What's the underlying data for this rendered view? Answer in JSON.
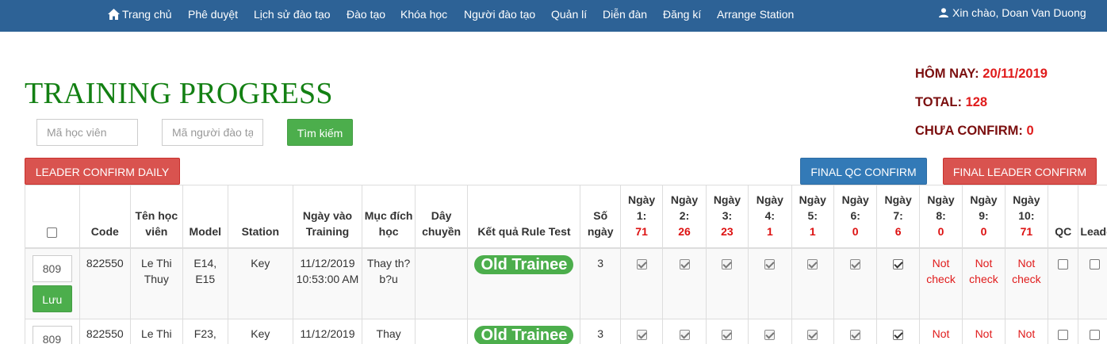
{
  "nav": {
    "items": [
      "Trang chủ",
      "Phê duyệt",
      "Lịch sử đào tạo",
      "Đào tạo",
      "Khóa học",
      "Người đào tạo",
      "Quản lí",
      "Diễn đàn",
      "Đăng kí",
      "Arrange Station"
    ],
    "user_greeting": "Xin chào, Doan Van Duong"
  },
  "page_title": "TRAINING PROGRESS",
  "stats": {
    "today_label": "HÔM NAY:",
    "today_value": "20/11/2019",
    "total_label": "TOTAL:",
    "total_value": "128",
    "unconfirmed_label": "CHƯA CONFIRM:",
    "unconfirmed_value": "0"
  },
  "search": {
    "trainee_placeholder": "Mã học viên",
    "trainer_placeholder": "Mã người đào tạo",
    "button_label": "Tìm kiếm"
  },
  "actions": {
    "leader_confirm_daily": "LEADER CONFIRM DAILY",
    "final_qc_confirm": "FINAL QC CONFIRM",
    "final_leader_confirm": "FINAL LEADER CONFIRM"
  },
  "table": {
    "headers": {
      "code": "Code",
      "name": "Tên học viên",
      "model": "Model",
      "station": "Station",
      "date_in": "Ngày vào Training",
      "purpose": "Mục đích học",
      "line": "Dây chuyền",
      "rule_test": "Kết quả Rule Test",
      "days": "Số ngày",
      "qc": "QC",
      "leader": "Leader"
    },
    "day_headers": [
      {
        "label": "Ngày 1:",
        "count": "71"
      },
      {
        "label": "Ngày 2:",
        "count": "26"
      },
      {
        "label": "Ngày 3:",
        "count": "23"
      },
      {
        "label": "Ngày 4:",
        "count": "1"
      },
      {
        "label": "Ngày 5:",
        "count": "1"
      },
      {
        "label": "Ngày 6:",
        "count": "0"
      },
      {
        "label": "Ngày 7:",
        "count": "6"
      },
      {
        "label": "Ngày 8:",
        "count": "0"
      },
      {
        "label": "Ngày 9:",
        "count": "0"
      },
      {
        "label": "Ngày 10:",
        "count": "71"
      }
    ],
    "save_label": "Lưu",
    "rows": [
      {
        "id_value": "809",
        "code": "822550",
        "name": "Le Thi Thuy",
        "model": "E14, E15",
        "station": "Key",
        "date_in": "11/12/2019 10:53:00 AM",
        "purpose": "Thay th? b?u",
        "line": "",
        "rule_test": "Old Trainee",
        "days": "3",
        "not_check": "Not check"
      },
      {
        "id_value": "809",
        "code": "822550",
        "name": "Le Thi",
        "model": "F23,",
        "station": "Key",
        "date_in": "11/12/2019",
        "purpose": "Thay",
        "line": "",
        "rule_test": "Old Trainee",
        "days": "3",
        "not_check": "Not"
      }
    ]
  },
  "colors": {
    "navbar": "#2d6296",
    "title": "#138013",
    "accent_red": "#e01b1b",
    "dark_red": "#7b0f0f",
    "green": "#4cae4c",
    "blue": "#337ab7"
  }
}
